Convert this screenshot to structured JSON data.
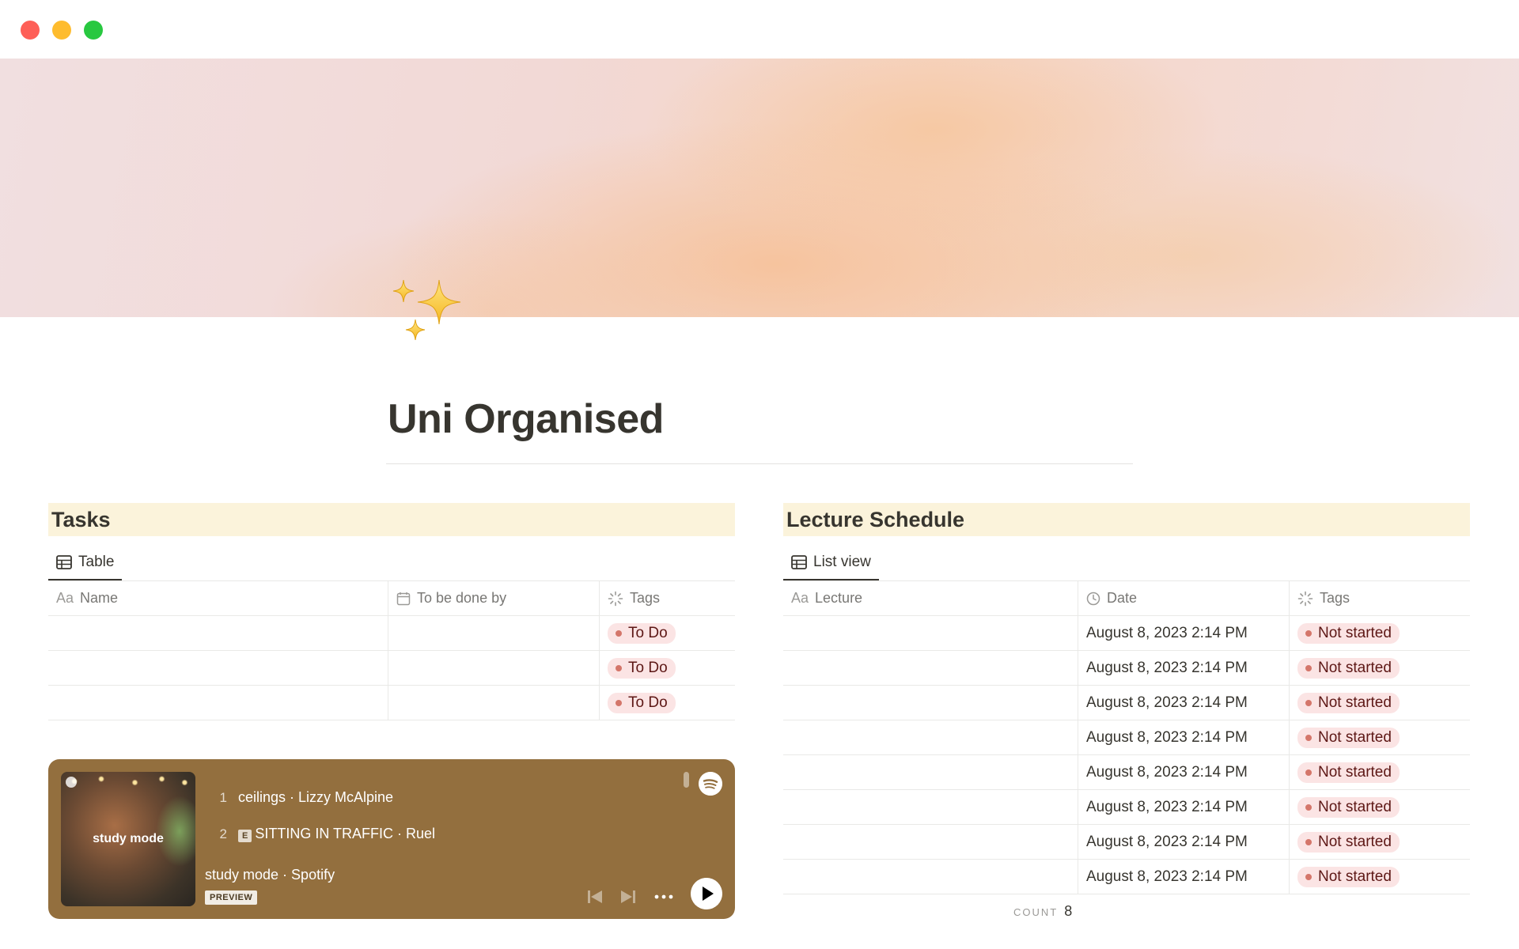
{
  "window": {
    "controls": [
      "close",
      "minimize",
      "maximize"
    ]
  },
  "page": {
    "title": "Uni Organised",
    "icon": "sparkles-icon"
  },
  "tasks": {
    "heading": "Tasks",
    "view_label": "Table",
    "columns": [
      {
        "prefix": "Aa",
        "label": "Name"
      },
      {
        "label": "To be done by"
      },
      {
        "label": "Tags"
      }
    ],
    "rows": [
      {
        "name": "",
        "due": "",
        "tag": "To Do"
      },
      {
        "name": "",
        "due": "",
        "tag": "To Do"
      },
      {
        "name": "",
        "due": "",
        "tag": "To Do"
      }
    ]
  },
  "lectures": {
    "heading": "Lecture Schedule",
    "view_label": "List view",
    "columns": [
      {
        "prefix": "Aa",
        "label": "Lecture"
      },
      {
        "label": "Date"
      },
      {
        "label": "Tags"
      }
    ],
    "rows": [
      {
        "lecture": "",
        "date": "August 8, 2023 2:14 PM",
        "tag": "Not started"
      },
      {
        "lecture": "",
        "date": "August 8, 2023 2:14 PM",
        "tag": "Not started"
      },
      {
        "lecture": "",
        "date": "August 8, 2023 2:14 PM",
        "tag": "Not started"
      },
      {
        "lecture": "",
        "date": "August 8, 2023 2:14 PM",
        "tag": "Not started"
      },
      {
        "lecture": "",
        "date": "August 8, 2023 2:14 PM",
        "tag": "Not started"
      },
      {
        "lecture": "",
        "date": "August 8, 2023 2:14 PM",
        "tag": "Not started"
      },
      {
        "lecture": "",
        "date": "August 8, 2023 2:14 PM",
        "tag": "Not started"
      },
      {
        "lecture": "",
        "date": "August 8, 2023 2:14 PM",
        "tag": "Not started"
      }
    ],
    "count_label": "COUNT",
    "count_value": "8"
  },
  "spotify": {
    "cover_text": "study mode",
    "tracks": [
      {
        "number": "1",
        "explicit": false,
        "text": "ceilings · Lizzy McAlpine"
      },
      {
        "number": "2",
        "explicit": true,
        "explicit_label": "E",
        "text": "SITTING IN TRAFFIC · Ruel"
      }
    ],
    "playlist_line": "study mode · Spotify",
    "preview_label": "PREVIEW",
    "background_color": "#936f3e"
  },
  "colors": {
    "section_header_bg": "#fbf3db",
    "tag_bg": "#fbe4e4",
    "tag_dot": "#d4766a",
    "tag_text": "#5d1715"
  }
}
